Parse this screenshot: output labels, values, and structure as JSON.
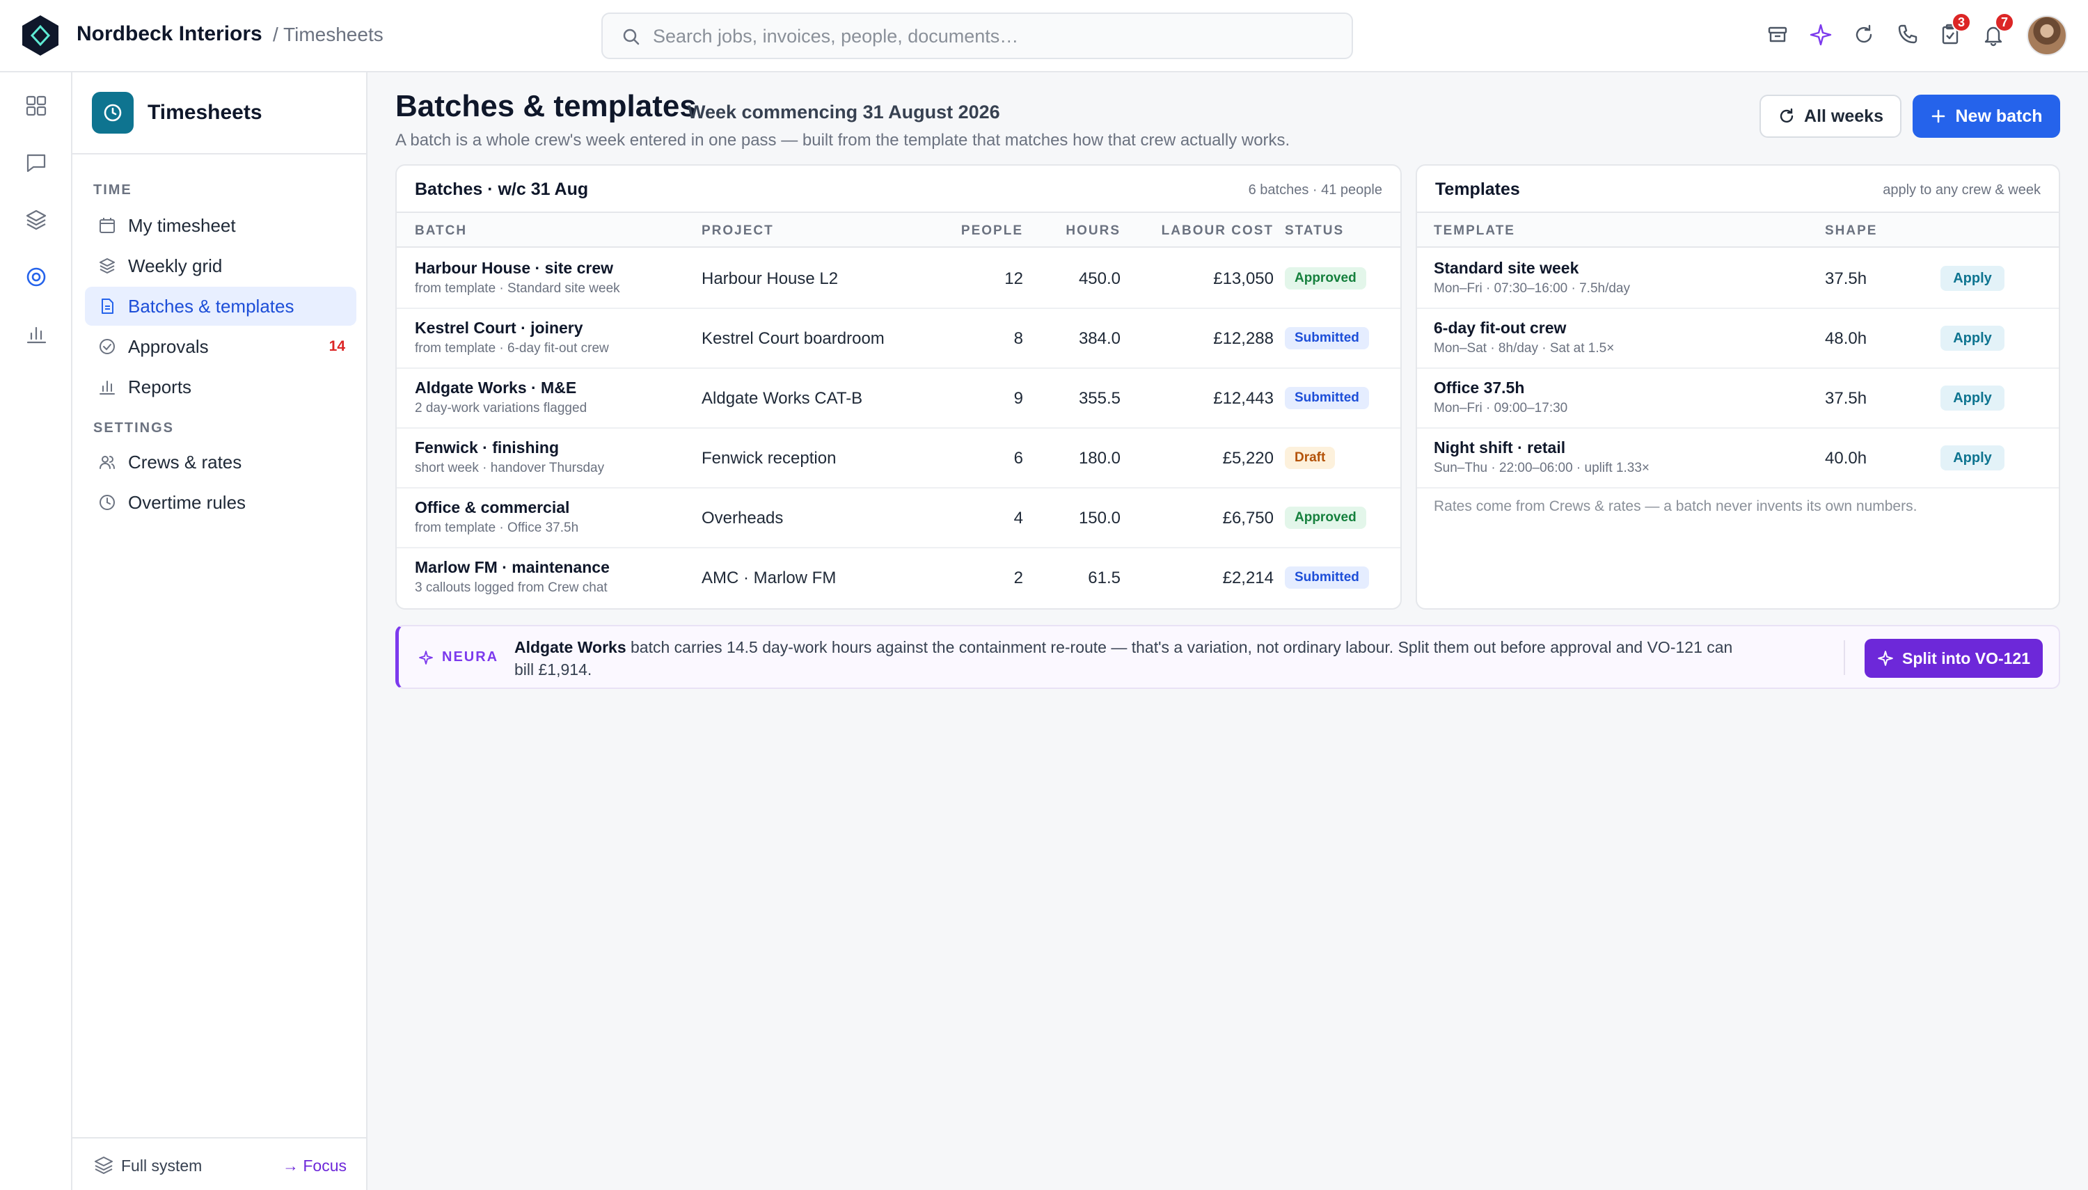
{
  "app": {
    "company": "Nordbeck Interiors",
    "breadcrumb": "/ Timesheets",
    "search_placeholder": "Search jobs, invoices, people, documents…"
  },
  "topbar_icons": [
    {
      "name": "archive-icon"
    },
    {
      "name": "sparkle-icon"
    },
    {
      "name": "refresh-icon"
    },
    {
      "name": "phone-icon"
    },
    {
      "name": "tasks-icon",
      "badge": "3"
    },
    {
      "name": "bell-icon",
      "badge": "7"
    }
  ],
  "sidebar": {
    "title": "Timesheets",
    "time_label": "TIME",
    "settings_label": "SETTINGS",
    "items": [
      {
        "label": "My timesheet",
        "icon": "calendar-icon"
      },
      {
        "label": "Weekly grid",
        "icon": "layers-icon"
      },
      {
        "label": "Batches & templates",
        "icon": "document-icon",
        "active": true
      },
      {
        "label": "Approvals",
        "icon": "check-circle-icon",
        "count": "14"
      },
      {
        "label": "Reports",
        "icon": "bar-chart-icon"
      }
    ],
    "settings_items": [
      {
        "label": "Crews & rates",
        "icon": "people-icon"
      },
      {
        "label": "Overtime rules",
        "icon": "clock-icon"
      }
    ],
    "footer": {
      "label": "Full system",
      "focus": "→ Focus"
    }
  },
  "header": {
    "title": "Batches & templates",
    "week": "Week commencing 31 August 2026",
    "subtitle": "A batch is a whole crew's week entered in one pass — built from the template that matches how that crew actually works.",
    "all_weeks": "All weeks",
    "new_batch": "New batch"
  },
  "batches": {
    "title": "Batches · w/c 31 Aug",
    "meta": "6 batches · 41 people",
    "columns": [
      "BATCH",
      "PROJECT",
      "PEOPLE",
      "HOURS",
      "LABOUR COST",
      "STATUS"
    ],
    "rows": [
      {
        "name": "Harbour House · site crew",
        "sub": "from template · Standard site week",
        "project": "Harbour House L2",
        "people": "12",
        "hours": "450.0",
        "cost": "£13,050",
        "status": "Approved",
        "status_kind": "approved"
      },
      {
        "name": "Kestrel Court · joinery",
        "sub": "from template · 6-day fit-out crew",
        "project": "Kestrel Court boardroom",
        "people": "8",
        "hours": "384.0",
        "cost": "£12,288",
        "status": "Submitted",
        "status_kind": "submitted"
      },
      {
        "name": "Aldgate Works · M&E",
        "sub": "2 day-work variations flagged",
        "project": "Aldgate Works CAT-B",
        "people": "9",
        "hours": "355.5",
        "cost": "£12,443",
        "status": "Submitted",
        "status_kind": "submitted"
      },
      {
        "name": "Fenwick · finishing",
        "sub": "short week · handover Thursday",
        "project": "Fenwick reception",
        "people": "6",
        "hours": "180.0",
        "cost": "£5,220",
        "status": "Draft",
        "status_kind": "draft"
      },
      {
        "name": "Office & commercial",
        "sub": "from template · Office 37.5h",
        "project": "Overheads",
        "people": "4",
        "hours": "150.0",
        "cost": "£6,750",
        "status": "Approved",
        "status_kind": "approved"
      },
      {
        "name": "Marlow FM · maintenance",
        "sub": "3 callouts logged from Crew chat",
        "project": "AMC · Marlow FM",
        "people": "2",
        "hours": "61.5",
        "cost": "£2,214",
        "status": "Submitted",
        "status_kind": "submitted"
      }
    ]
  },
  "templates": {
    "title": "Templates",
    "meta": "apply to any crew & week",
    "columns": [
      "TEMPLATE",
      "SHAPE"
    ],
    "apply_label": "Apply",
    "rows": [
      {
        "name": "Standard site week",
        "sub": "Mon–Fri · 07:30–16:00 · 7.5h/day",
        "shape": "37.5h"
      },
      {
        "name": "6-day fit-out crew",
        "sub": "Mon–Sat · 8h/day · Sat at 1.5×",
        "shape": "48.0h"
      },
      {
        "name": "Office 37.5h",
        "sub": "Mon–Fri · 09:00–17:30",
        "shape": "37.5h"
      },
      {
        "name": "Night shift · retail",
        "sub": "Sun–Thu · 22:00–06:00 · uplift 1.33×",
        "shape": "40.0h"
      }
    ],
    "note": "Rates come from Crews & rates — a batch never invents its own numbers."
  },
  "neura": {
    "tag": "NEURA",
    "highlight": "Aldgate Works",
    "message": " batch carries 14.5 day-work hours against the containment re-route — that's a variation, not ordinary labour. Split them out before approval and VO-121 can bill £1,914.",
    "action": "Split into VO-121"
  }
}
